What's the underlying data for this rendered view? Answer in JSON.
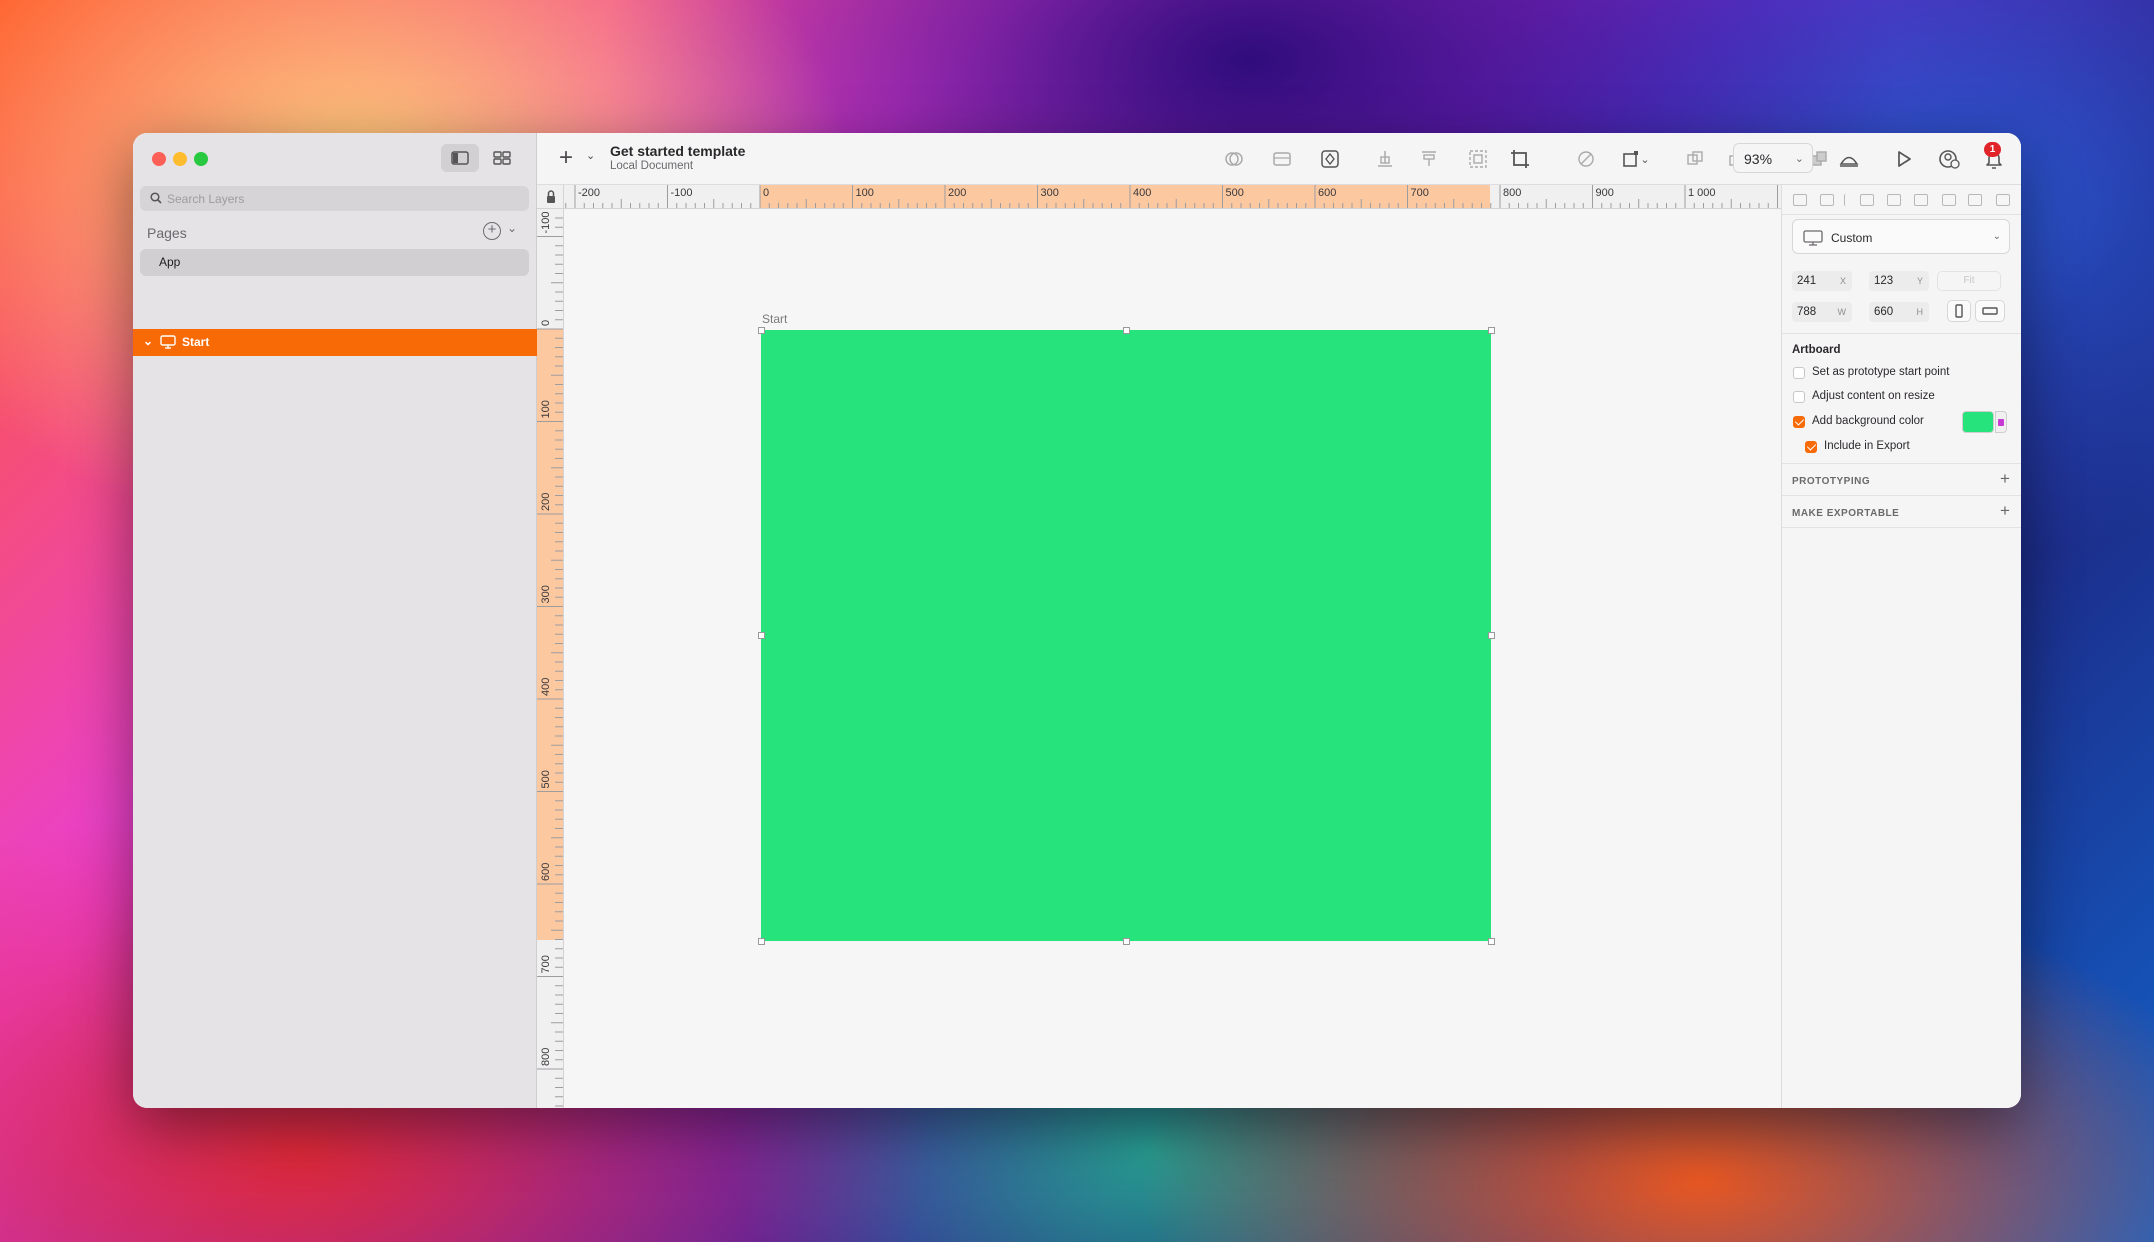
{
  "sidebar": {
    "search_placeholder": "Search Layers",
    "pages_title": "Pages",
    "pages": [
      {
        "label": "App"
      }
    ],
    "layers": [
      {
        "label": "Start"
      }
    ]
  },
  "toolbar": {
    "doc_title": "Get started template",
    "doc_subtitle": "Local Document",
    "zoom": "93%",
    "notifications_count": "1"
  },
  "rulers": {
    "horizontal": [
      "-200",
      "-100",
      "0",
      "100",
      "200",
      "300",
      "400",
      "500",
      "600",
      "700",
      "800",
      "900",
      "1 000"
    ],
    "vertical": [
      "-100",
      "0",
      "100",
      "200",
      "300",
      "400",
      "500",
      "600",
      "700",
      "800"
    ]
  },
  "canvas": {
    "artboard_label": "Start",
    "artboard_color": "#26e47b"
  },
  "inspector": {
    "preset": "Custom",
    "x": "241",
    "x_unit": "X",
    "y": "123",
    "y_unit": "Y",
    "w": "788",
    "w_unit": "W",
    "h": "660",
    "h_unit": "H",
    "fit_label": "Fit",
    "section_title": "Artboard",
    "options": [
      {
        "label": "Set as prototype start point",
        "checked": false
      },
      {
        "label": "Adjust content on resize",
        "checked": false
      },
      {
        "label": "Add background color",
        "checked": true
      },
      {
        "label": "Include in Export",
        "checked": true
      }
    ],
    "bg_color": "#26e47b",
    "prototyping_label": "PROTOTYPING",
    "exportable_label": "MAKE EXPORTABLE"
  },
  "colors": {
    "accent": "#f86a06",
    "ruler_highlight": "#fbc8a0"
  }
}
